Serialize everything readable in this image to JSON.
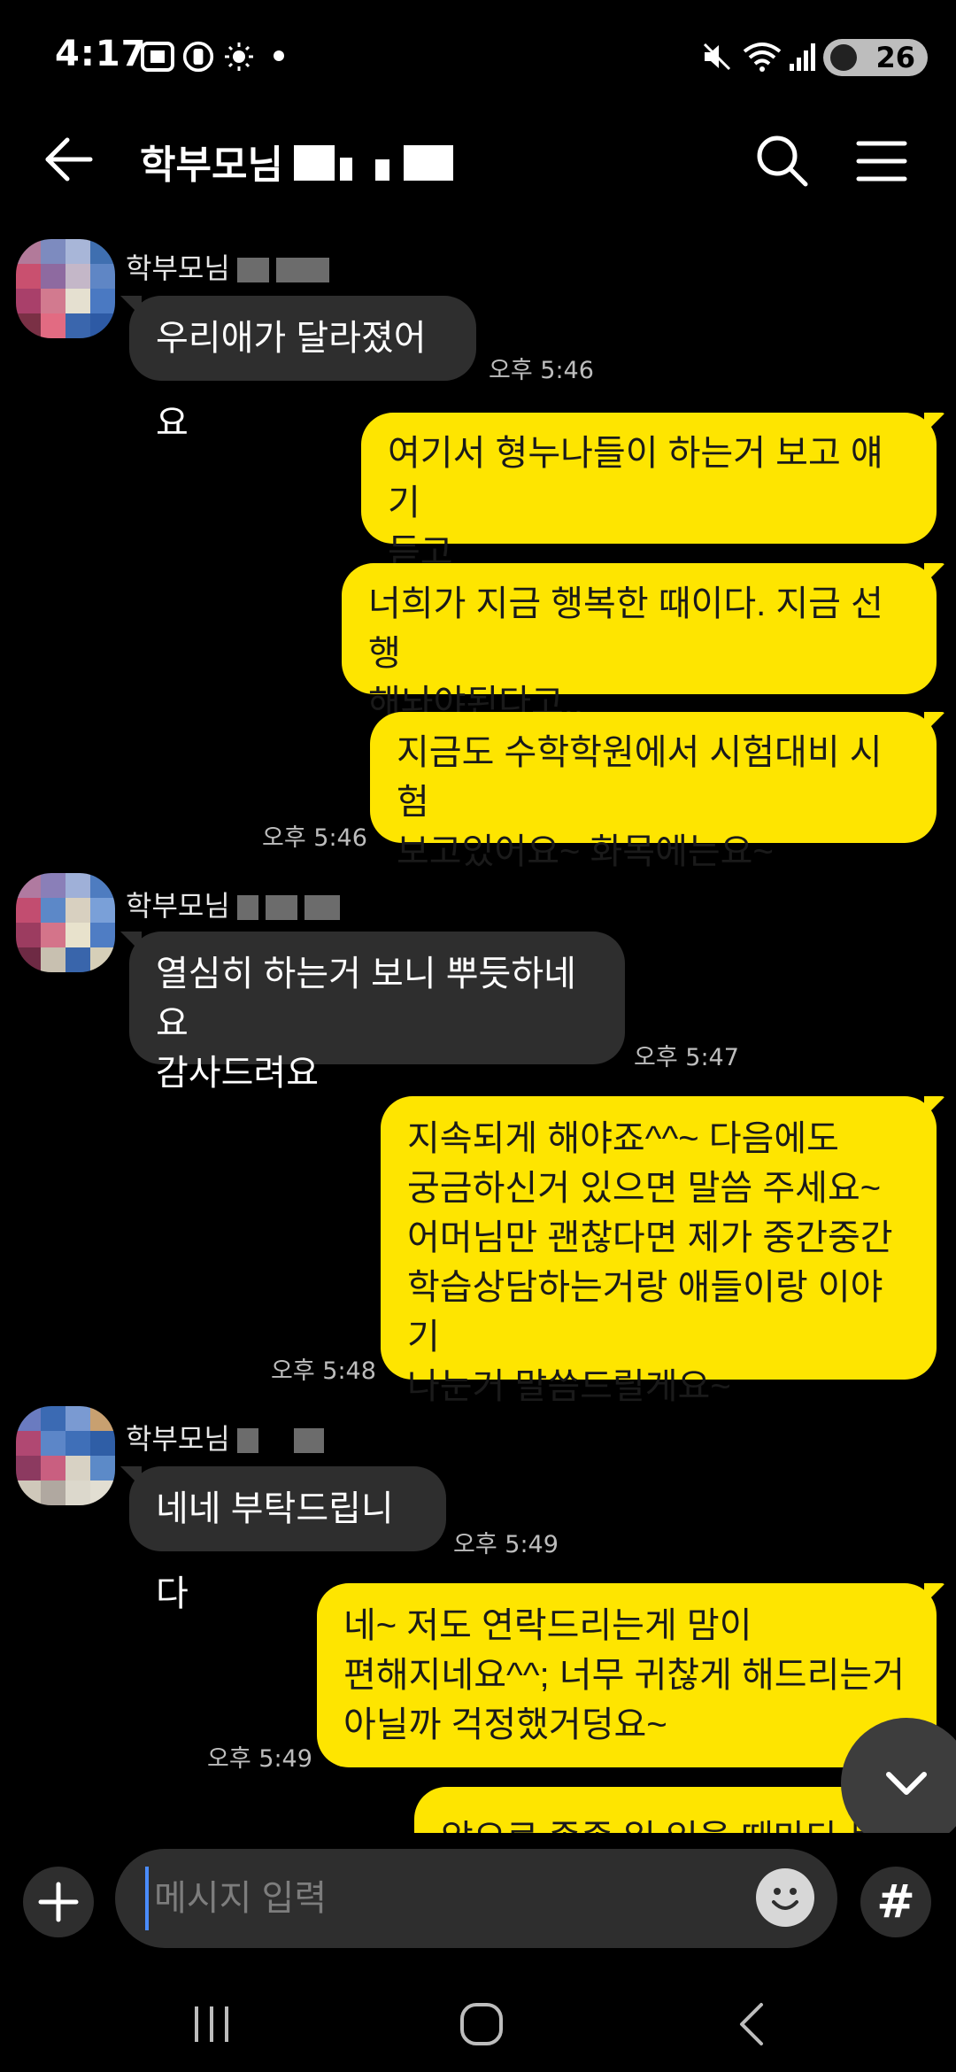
{
  "status_bar": {
    "time": "4:17",
    "battery": "26"
  },
  "header": {
    "title": "학부모님"
  },
  "messages": [
    {
      "sender": "학부모님",
      "text": "우리애가 달라졌어요",
      "time": "오후 5:46"
    },
    {
      "text": "여기서 형누나들이 하는거 보고 얘기 듣고"
    },
    {
      "text": "너희가 지금 행복한 때이다. 지금 선행 해놔야된다고.."
    },
    {
      "text": "지금도 수학학원에서 시험대비 시험 보고있어요~ 화목에는요~",
      "time": "오후 5:46"
    },
    {
      "sender": "학부모님",
      "text": "열심히 하는거 보니 뿌듯하네요 감사드려요",
      "time": "오후 5:47"
    },
    {
      "text": "지속되게 해야죠^^~ 다음에도 궁금하신거 있으면 말씀 주세요~ 어머님만 괜찮다면 제가 중간중간 학습상담하는거랑 애들이랑 이야기 나눈거 말씀드릴게요~",
      "time": "오후 5:48"
    },
    {
      "sender": "학부모님",
      "text": "네네 부탁드립니다",
      "time": "오후 5:49"
    },
    {
      "text": "네~ 저도 연락드리는게 맘이 편해지네요^^; 너무 귀찮게 해드리는거 아닐까 걱정했거덩요~",
      "time": "오후 5:49"
    },
    {
      "text": "앞으로 종종 일 있을 때마다 문자"
    }
  ],
  "lines": {
    "m1": [
      "여기서 형누나들이 하는거 보고 얘기",
      "듣고"
    ],
    "m2": [
      "너희가 지금 행복한 때이다. 지금 선행",
      "해놔야된다고.."
    ],
    "m3": [
      "지금도 수학학원에서 시험대비 시험",
      "보고있어요~ 화목에는요~"
    ],
    "m4": [
      "열심히 하는거 보니 뿌듯하네요",
      "감사드려요"
    ],
    "m5": [
      "지속되게 해야죠^^~ 다음에도",
      "궁금하신거 있으면 말씀 주세요~",
      "어머님만 괜찮다면 제가 중간중간",
      "학습상담하는거랑 애들이랑 이야기",
      "나눈거 말씀드릴게요~"
    ],
    "m7": [
      "네~ 저도 연락드리는게 맘이 ",
      "편해지네요^^; 너무 귀찮게 해드리는거",
      "아닐까 걱정했거덩요~"
    ]
  },
  "input": {
    "placeholder": "메시지 입력"
  },
  "icons": {
    "back": "arrow-left-icon",
    "search": "search-icon",
    "menu": "hamburger-menu-icon",
    "plus": "plus-icon",
    "emoji": "emoji-icon",
    "hash": "hashtag-icon",
    "scroll": "chevron-down-icon"
  },
  "hash_symbol": "#",
  "colors": {
    "outgoing": "#fee500",
    "incoming": "#2e2e2e",
    "background": "#000000"
  }
}
